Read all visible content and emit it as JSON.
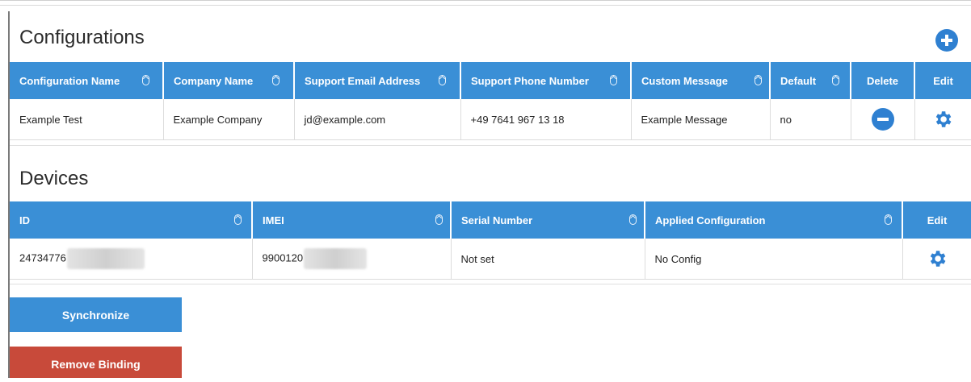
{
  "configurations": {
    "title": "Configurations",
    "add_button_icon": "plus-circle-icon",
    "columns": [
      {
        "label": "Configuration Name",
        "sortable": true
      },
      {
        "label": "Company Name",
        "sortable": true
      },
      {
        "label": "Support Email Address",
        "sortable": true
      },
      {
        "label": "Support Phone Number",
        "sortable": true
      },
      {
        "label": "Custom Message",
        "sortable": true
      },
      {
        "label": "Default",
        "sortable": true
      },
      {
        "label": "Delete",
        "sortable": false
      },
      {
        "label": "Edit",
        "sortable": false
      }
    ],
    "rows": [
      {
        "configuration_name": "Example Test",
        "company_name": "Example Company",
        "support_email": "jd@example.com",
        "support_phone": "+49 7641 967 13 18",
        "custom_message": "Example Message",
        "default": "no",
        "delete_icon": "minus-circle-icon",
        "edit_icon": "gear-icon"
      }
    ]
  },
  "devices": {
    "title": "Devices",
    "columns": [
      {
        "label": "ID",
        "sortable": true
      },
      {
        "label": "IMEI",
        "sortable": true
      },
      {
        "label": "Serial Number",
        "sortable": true
      },
      {
        "label": "Applied Configuration",
        "sortable": true
      },
      {
        "label": "Edit",
        "sortable": false
      }
    ],
    "rows": [
      {
        "id": "24734776",
        "imei": "9900120",
        "serial_number": "Not set",
        "applied_configuration": "No Config",
        "edit_icon": "gear-icon"
      }
    ]
  },
  "actions": {
    "synchronize_label": "Synchronize",
    "remove_binding_label": "Remove Binding"
  },
  "colors": {
    "header_blue": "#3a8fd6",
    "icon_blue": "#2f80d1",
    "danger_red": "#c84a3a"
  }
}
